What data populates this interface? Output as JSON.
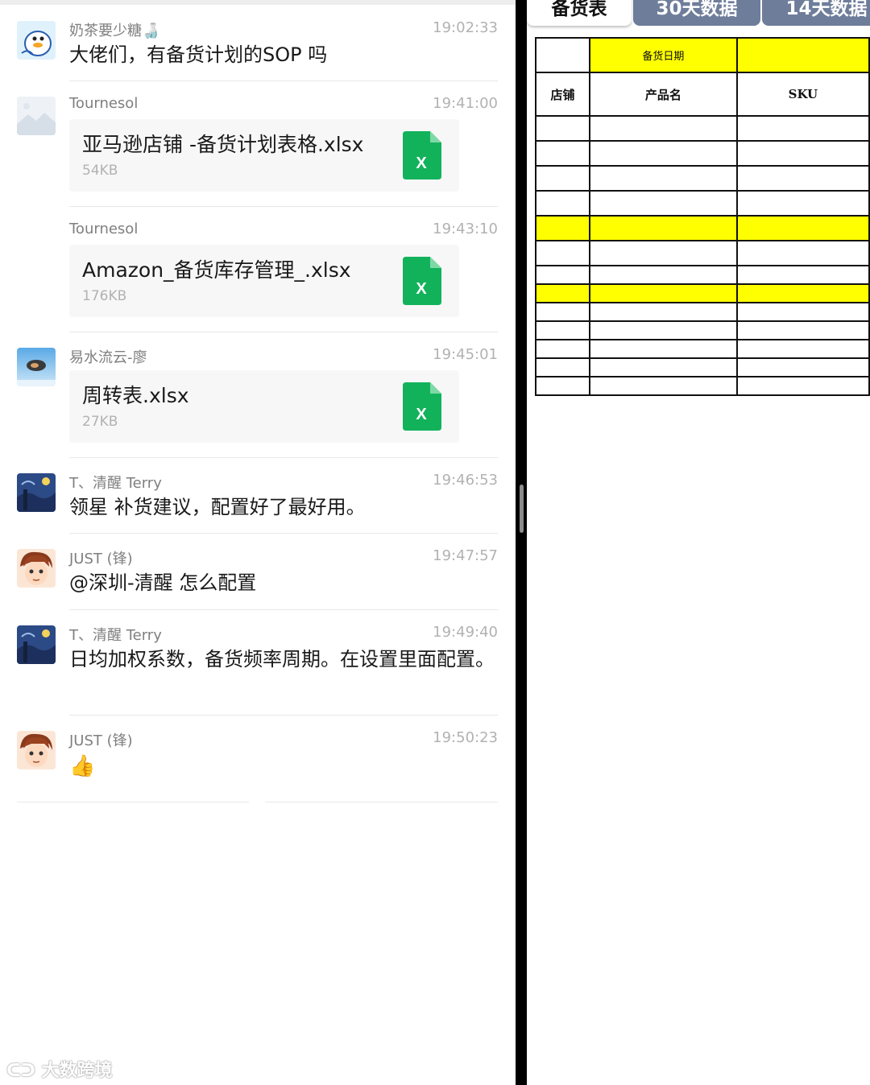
{
  "chat": {
    "messages": [
      {
        "sender": "奶茶要少糖🍶",
        "time": "19:02:33",
        "type": "text",
        "text": "大佬们，有备货计划的SOP 吗"
      },
      {
        "sender": "Tournesol",
        "time": "19:41:00",
        "type": "file",
        "file_name": "亚马逊店铺 -备货计划表格.xlsx",
        "file_size": "54KB"
      },
      {
        "sender": "Tournesol",
        "time": "19:43:10",
        "type": "file",
        "file_name": "Amazon_备货库存管理_.xlsx",
        "file_size": "176KB"
      },
      {
        "sender": "易水流云-廖",
        "time": "19:45:01",
        "type": "file",
        "file_name": "周转表.xlsx",
        "file_size": "27KB"
      },
      {
        "sender": "T、清醒 Terry",
        "time": "19:46:53",
        "type": "text",
        "text": "领星 补货建议，配置好了最好用。"
      },
      {
        "sender": "JUST (锋)",
        "time": "19:47:57",
        "type": "text",
        "text": "@深圳-清醒 怎么配置"
      },
      {
        "sender": "T、清醒 Terry",
        "time": "19:49:40",
        "type": "text",
        "text": "日均加权系数，备货频率周期。在设置里面配置。"
      },
      {
        "sender": "JUST (锋)",
        "time": "19:50:23",
        "type": "emoji",
        "emoji": "👍"
      }
    ],
    "file_icon_letter": "X",
    "colors": {
      "excel_green": "#12b25b",
      "separator": "#e8e8e8",
      "file_card": "#f7f7f7"
    }
  },
  "spreadsheet": {
    "tabs": [
      "备货表",
      "30天数据",
      "14天数据"
    ],
    "active_tab": "备货表",
    "header_row_1": {
      "col2": "备货日期"
    },
    "header_row_2": {
      "col1": "店铺",
      "col2": "产品名",
      "col3": "SKU"
    },
    "highlight_color": "#ffff00",
    "tab_color": "#6e7d9a"
  },
  "watermark": {
    "text": "大数跨境"
  }
}
